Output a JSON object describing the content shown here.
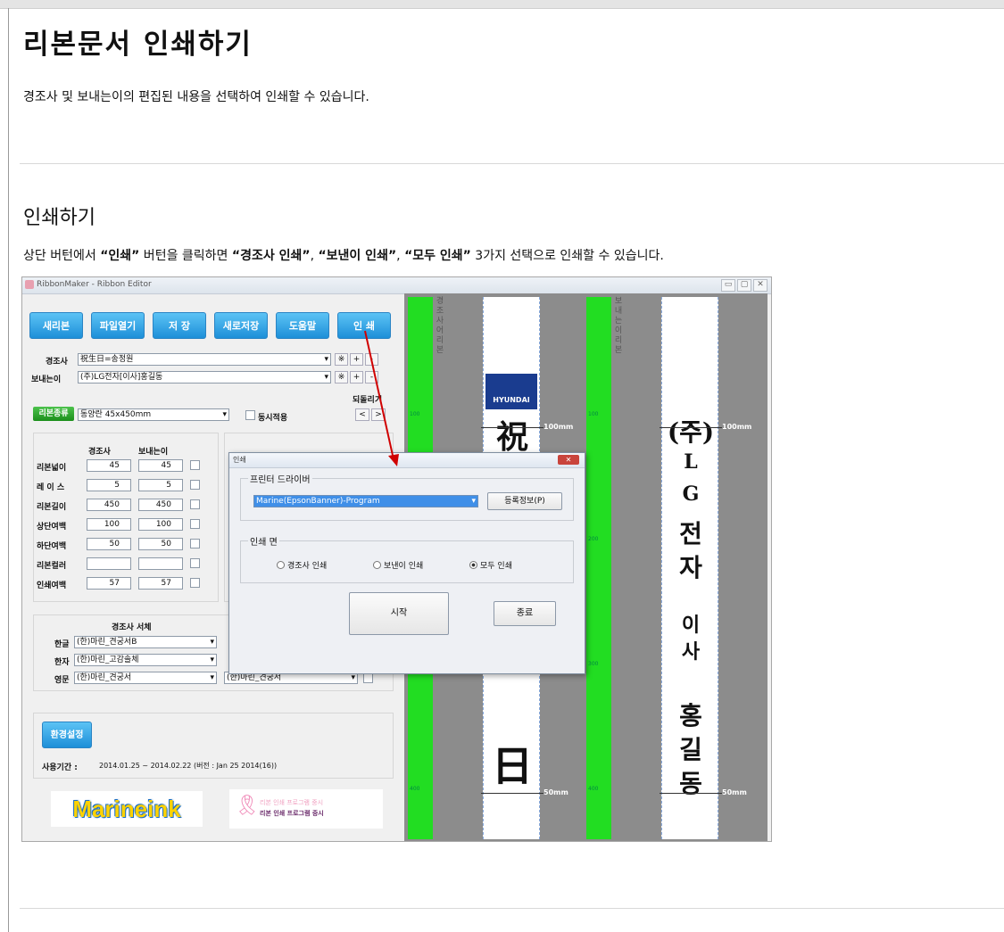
{
  "page": {
    "title": "리본문서 인쇄하기",
    "intro": "경조사 및 보내는이의 편집된 내용을 선택하여 인쇄할 수 있습니다.",
    "section_title": "인쇄하기",
    "desc_prefix": "상단 버턴에서 ",
    "desc_btn": "“인쇄”",
    "desc_mid": " 버턴을 클릭하면 ",
    "desc_opt1": "“경조사 인쇄”",
    "desc_sep1": ", ",
    "desc_opt2": "“보낸이 인쇄”",
    "desc_sep2": ", ",
    "desc_opt3": "“모두 인쇄”",
    "desc_suffix": " 3가지 선택으로 인쇄할 수 있습니다."
  },
  "app": {
    "window_title": "RibbonMaker - Ribbon Editor",
    "toolbar": [
      "새리본",
      "파일열기",
      "저 장",
      "새로저장",
      "도움말",
      "인 쇄"
    ],
    "row1_label": "경조사",
    "row1_value": "祝生日=송정원",
    "row2_label": "보내는이",
    "row2_value": "(주)LG전자[이사]홍길동",
    "symbols": [
      "※",
      "+",
      "-"
    ],
    "undo_label": "되돌리기",
    "undo_buttons": [
      "<",
      ">"
    ],
    "ribbon_type_btn": "리본종류",
    "ribbon_type_value": "동양란 45x450mm",
    "simultaneous": "동시적용",
    "grid_headers": [
      "경조사",
      "보내는이"
    ],
    "grid_rows": [
      {
        "label": "리본넓이",
        "a": "45",
        "b": "45"
      },
      {
        "label": "레 이 스",
        "a": "5",
        "b": "5"
      },
      {
        "label": "리본길이",
        "a": "450",
        "b": "450"
      },
      {
        "label": "상단여백",
        "a": "100",
        "b": "100"
      },
      {
        "label": "하단여백",
        "a": "50",
        "b": "50"
      },
      {
        "label": "리본컬러",
        "a": "",
        "b": ""
      },
      {
        "label": "인쇄여백",
        "a": "57",
        "b": "57"
      }
    ],
    "font_header": "경조사 서체",
    "font_header_right": "경조사 보내는이",
    "fonts": [
      {
        "label": "한글",
        "value": "(한)마린_견궁서B"
      },
      {
        "label": "한자",
        "value": "(한)마린_고감솔체"
      },
      {
        "label": "영문",
        "value": "(한)마린_견궁서"
      }
    ],
    "font_right_value": "(한)마린_견궁서",
    "settings_btn": "환경설정",
    "usage_label": "사용기간 :",
    "usage_value": "2014.01.25 ~ 2014.02.22 (버전 : Jan 25 2014(16))",
    "logo_text": "Marineink",
    "logo2_line1": "리본 인쇄 프로그램 중시",
    "logo2_line2": "리본 인쇄 프로그램 중시",
    "preview_left": {
      "header": "경조사어 리본",
      "sponsor": "HYUNDAI",
      "chars": [
        "祝",
        "日"
      ],
      "mm_top": "100mm",
      "mm_bottom": "50mm",
      "ticks": [
        "100",
        "200",
        "300",
        "400"
      ]
    },
    "preview_right": {
      "header": "보내는이 리본",
      "chars": [
        "(주)",
        "L",
        "G",
        "전",
        "자",
        "이",
        "사",
        "홍",
        "길",
        "동"
      ],
      "mm_top": "100mm",
      "mm_bottom": "50mm",
      "ticks": [
        "100",
        "200",
        "300",
        "400"
      ]
    }
  },
  "dialog": {
    "title": "인쇄",
    "close": "✕",
    "printer_group": "프린터 드라이버",
    "printer_value": "Marine(EpsonBanner)-Program",
    "printer_info_btn": "등록정보(P)",
    "side_group": "인쇄 면",
    "options": [
      "경조사 인쇄",
      "보낸이 인쇄",
      "모두 인쇄"
    ],
    "selected": "모두 인쇄",
    "start_btn": "시작",
    "close_btn": "종료"
  },
  "colors": {
    "accent_blue": "#1d8fd8",
    "ruler_green": "#22dd22",
    "arrow_red": "#d00000"
  }
}
